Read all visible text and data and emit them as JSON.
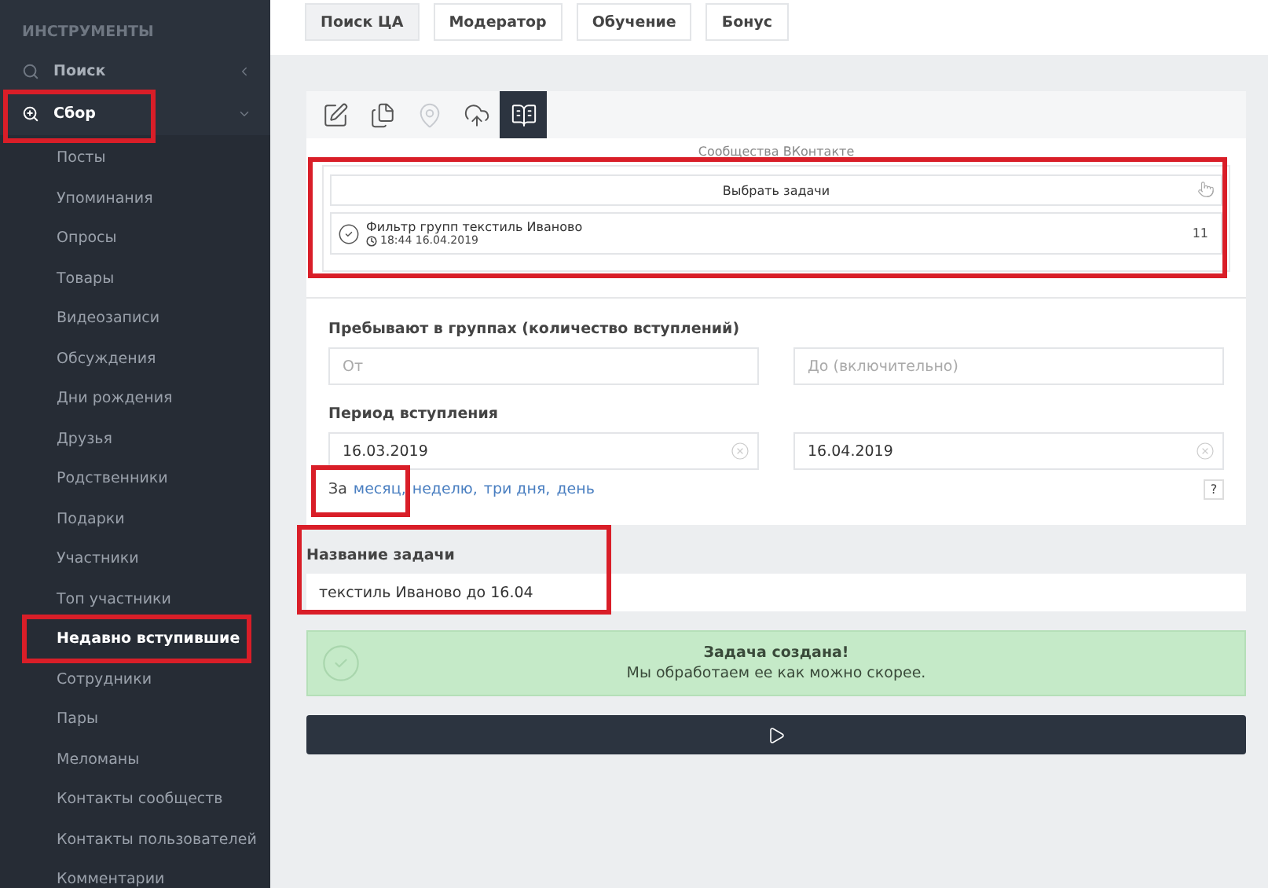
{
  "sidebar": {
    "heading": "ИНСТРУМЕНТЫ",
    "items": [
      {
        "label": "Поиск",
        "kind": "search",
        "expanded": false,
        "highlighted": false
      },
      {
        "label": "Сбор",
        "kind": "zoom",
        "expanded": true,
        "highlighted": true,
        "children": [
          {
            "label": "Посты",
            "selected": false,
            "highlighted": false
          },
          {
            "label": "Упоминания",
            "selected": false,
            "highlighted": false
          },
          {
            "label": "Опросы",
            "selected": false,
            "highlighted": false
          },
          {
            "label": "Товары",
            "selected": false,
            "highlighted": false
          },
          {
            "label": "Видеозаписи",
            "selected": false,
            "highlighted": false
          },
          {
            "label": "Обсуждения",
            "selected": false,
            "highlighted": false
          },
          {
            "label": "Дни рождения",
            "selected": false,
            "highlighted": false
          },
          {
            "label": "Друзья",
            "selected": false,
            "highlighted": false
          },
          {
            "label": "Родственники",
            "selected": false,
            "highlighted": false
          },
          {
            "label": "Подарки",
            "selected": false,
            "highlighted": false
          },
          {
            "label": "Участники",
            "selected": false,
            "highlighted": false
          },
          {
            "label": "Топ участники",
            "selected": false,
            "highlighted": false
          },
          {
            "label": "Недавно вступившие",
            "selected": true,
            "highlighted": true
          },
          {
            "label": "Сотрудники",
            "selected": false,
            "highlighted": false
          },
          {
            "label": "Пары",
            "selected": false,
            "highlighted": false
          },
          {
            "label": "Меломаны",
            "selected": false,
            "highlighted": false
          },
          {
            "label": "Контакты сообществ",
            "selected": false,
            "highlighted": false
          },
          {
            "label": "Контакты пользователей",
            "selected": false,
            "highlighted": false
          },
          {
            "label": "Комментарии",
            "selected": false,
            "highlighted": false
          }
        ]
      }
    ]
  },
  "top_tabs": [
    {
      "label": "Поиск ЦА",
      "selected": true
    },
    {
      "label": "Модератор",
      "selected": false
    },
    {
      "label": "Обучение",
      "selected": false
    },
    {
      "label": "Бонус",
      "selected": false
    }
  ],
  "toolbar": [
    {
      "kind": "edit",
      "selected": false,
      "disabled": false
    },
    {
      "kind": "copy",
      "selected": false,
      "disabled": false
    },
    {
      "kind": "pin",
      "selected": false,
      "disabled": true
    },
    {
      "kind": "upload",
      "selected": false,
      "disabled": false
    },
    {
      "kind": "book",
      "selected": true,
      "disabled": false
    }
  ],
  "source": {
    "label": "Сообщества ВКонтакте",
    "highlighted": true,
    "select_button": "Выбрать задачи",
    "tasks": [
      {
        "title": "Фильтр групп текстиль Иваново",
        "time": "18:44 16.04.2019",
        "count": "11",
        "checked": true
      }
    ]
  },
  "membership": {
    "label": "Пребывают в группах (количество вступлений)",
    "from_placeholder": "От",
    "to_placeholder": "До (включительно)"
  },
  "period": {
    "label": "Период вступления",
    "from": "16.03.2019",
    "to": "16.04.2019",
    "quick_prefix": "За",
    "quick_links": [
      "месяц,",
      "неделю,",
      "три дня,",
      "день"
    ],
    "highlighted": true,
    "help": "?"
  },
  "task_name": {
    "label": "Название задачи",
    "value": "текстиль Иваново до 16.04",
    "highlighted": true
  },
  "alert": {
    "title": "Задача создана!",
    "message": "Мы обработаем ее как можно скорее."
  }
}
